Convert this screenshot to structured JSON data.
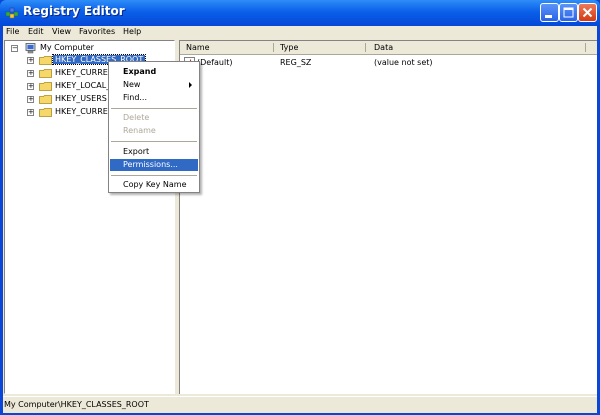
{
  "window": {
    "title": "Registry Editor"
  },
  "menubar": [
    "File",
    "Edit",
    "View",
    "Favorites",
    "Help"
  ],
  "tree": {
    "root": "My Computer",
    "items": [
      {
        "label": "HKEY_CLASSES_ROOT",
        "selected": true
      },
      {
        "label": "HKEY_CURREN",
        "selected": false
      },
      {
        "label": "HKEY_LOCAL_",
        "selected": false
      },
      {
        "label": "HKEY_USERS",
        "selected": false
      },
      {
        "label": "HKEY_CURREN",
        "selected": false
      }
    ]
  },
  "listview": {
    "columns": [
      "Name",
      "Type",
      "Data"
    ],
    "rows": [
      {
        "name": "(Default)",
        "type": "REG_SZ",
        "data": "(value not set)"
      }
    ]
  },
  "context_menu": {
    "items": [
      "Expand",
      "New",
      "Find...",
      "Delete",
      "Rename",
      "Export",
      "Permissions...",
      "Copy Key Name"
    ]
  },
  "status": {
    "text": "My Computer\\HKEY_CLASSES_ROOT"
  },
  "colors": {
    "title_bar": "#0a5fe8",
    "selection": "#316ac5",
    "close_button": "#d43a14"
  }
}
